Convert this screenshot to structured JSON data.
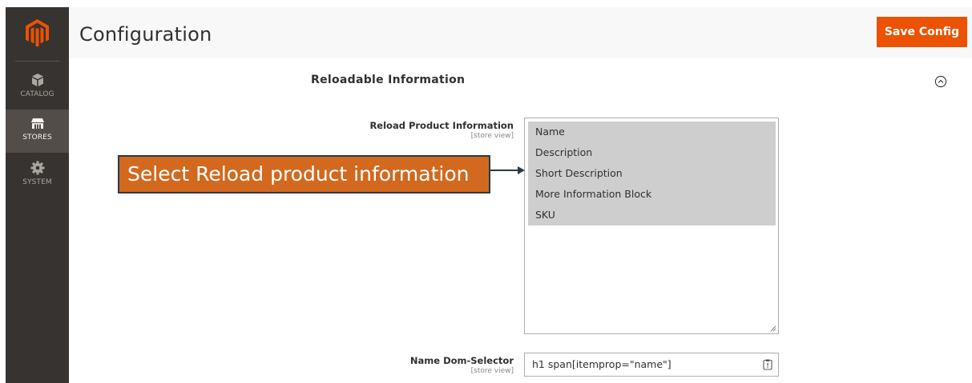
{
  "sidebar": {
    "logo_icon": "magento-logo-icon",
    "items": [
      {
        "label": "CATALOG",
        "icon": "cube-icon",
        "active": false
      },
      {
        "label": "STORES",
        "icon": "store-icon",
        "active": true
      },
      {
        "label": "SYSTEM",
        "icon": "gear-icon",
        "active": false
      }
    ]
  },
  "header": {
    "title": "Configuration",
    "save_label": "Save Config"
  },
  "section": {
    "title": "Reloadable Information",
    "collapse_icon": "chevron-up-circle-icon"
  },
  "fields": {
    "reload_info": {
      "label": "Reload Product Information",
      "scope": "[store view]",
      "options": [
        "Name",
        "Description",
        "Short Description",
        "More Information Block",
        "SKU"
      ]
    },
    "name_selector": {
      "label": "Name Dom-Selector",
      "scope": "[store view]",
      "value": "h1 span[itemprop=\"name\"]",
      "icon": "clipboard-icon"
    }
  },
  "callout": {
    "text": "Select Reload product information"
  },
  "colors": {
    "accent": "#eb5202",
    "sidebar": "#373330",
    "callout": "#d2691e"
  }
}
